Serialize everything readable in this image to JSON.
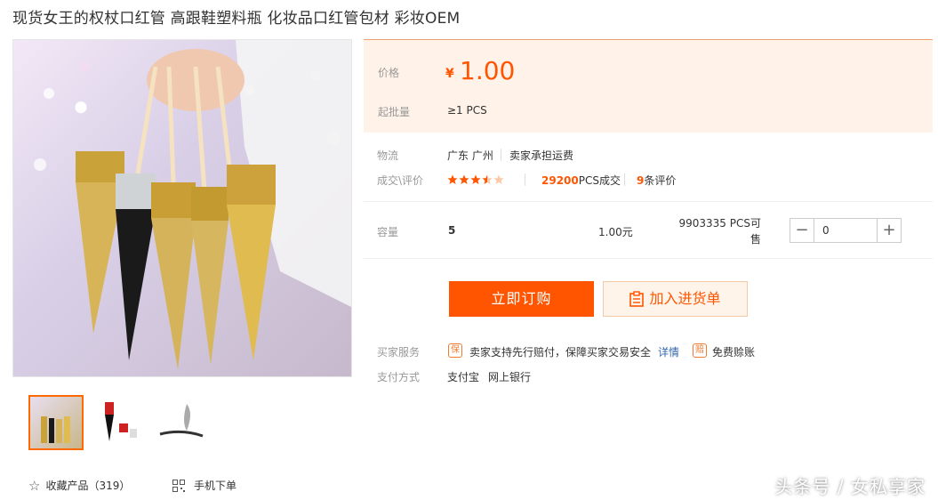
{
  "title": "现货女王的权杖口红管 高跟鞋塑料瓶 化妆品口红管包材 彩妆OEM",
  "price": {
    "label": "价格",
    "currency": "¥",
    "value": "1.00"
  },
  "moq": {
    "label": "起批量",
    "value": "≥1  PCS"
  },
  "logistics": {
    "label": "物流",
    "location": "广东 广州",
    "shipping": "卖家承担运费"
  },
  "deals": {
    "label": "成交\\评价",
    "rating": 3.5,
    "sold_count": "29200",
    "sold_suffix": "PCS成交",
    "review_count": "9",
    "review_suffix": "条评价"
  },
  "variant": {
    "label": "容量",
    "name": "5",
    "price": "1.00元",
    "stock": "9903335 PCS可售",
    "quantity": "0"
  },
  "buttons": {
    "buy": "立即订购",
    "cart": "加入进货单"
  },
  "services": {
    "label": "买家服务",
    "guarantee_badge": "保",
    "guarantee_text": "卖家支持先行赔付，保障买家交易安全",
    "details_link": "详情",
    "free_badge": "赔",
    "free_text": "免费赊账"
  },
  "payment": {
    "label": "支付方式",
    "methods": [
      "支付宝",
      "网上银行"
    ]
  },
  "bottom": {
    "favorite": "收藏产品（319）",
    "mobile_order": "手机下单"
  },
  "watermark": "头条号 / 女私享家",
  "colors": {
    "accent": "#ff5500",
    "price_bg": "#fff2e8"
  }
}
